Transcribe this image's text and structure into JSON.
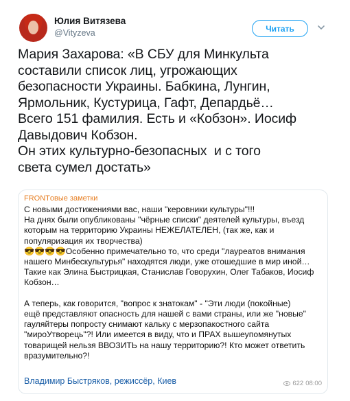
{
  "author": {
    "name": "Юлия Витязева",
    "handle": "@Vityzeva"
  },
  "follow_button": {
    "label": "Читать"
  },
  "tweet": {
    "text": "Мария Захарова: «В СБУ для Минкульта\nсоставили список лиц, угрожающих\nбезопасности Украины. Бабкина, Лунгин,\nЯрмольник, Кустурица, Гафт, Депардьё…\nВсего 151 фамилия. Есть и «Кобзон». Иосиф\nДавыдович Кобзон.\nОн этих культурно-безопасных  и с того\nсвета сумел достать»"
  },
  "card": {
    "source": "FRONTовые заметки",
    "body": "С новыми достижениями вас, наши \"керовники культуры\"!!!\nНа днях были опубликованы \"чёрные списки\" деятелей культуры, въезд\nкоторым на территорию Украины НЕЖЕЛАТЕЛЕН, (так же, как и\nпопуляризация их творчества)\n😎😎😎😎Особенно примечательно то, что среди \"лауреатов внимания\nнашего Минбескультурья\" находятся люди, уже отошедшие в мир иной…\nТакие как Элина Быстрицкая, Станислав Говорухин, Олег Табаков, Иосиф\nКобзон…\n\nА теперь, как говорится, \"вопрос к знатокам\" - \"Эти люди (покойные)\nещё представляют опасность для нашей с вами страны, или же \"новые\"\nгауляйтеры попросту снимают кальку с мерзопакостного сайта\n\"мироУтворець\"?! Или имеется в виду, что и ПРАХ вышеупомянутых\nтоварищей нельзя ВВОЗИТЬ на нашу территорию?! Кто может ответить\nвразумительно?!",
    "author": "Владимир Быстряков, режиссёр, Киев",
    "views": "622",
    "time": "08:00"
  },
  "colors": {
    "accent": "#1da1f2",
    "source": "#e67e22",
    "card_author": "#1b5fa8"
  },
  "icons": {
    "chevron": "chevron-down-icon",
    "views": "eye-icon"
  }
}
